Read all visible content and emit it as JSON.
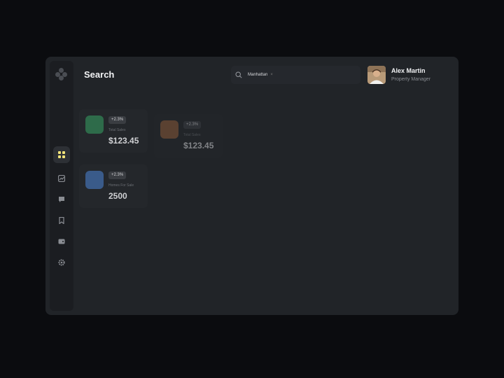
{
  "header": {
    "title": "Search"
  },
  "search": {
    "value": "Manhattan",
    "clear": "×"
  },
  "user": {
    "name": "Alex Martin",
    "role": "Property Manager"
  },
  "cards": [
    {
      "badge": "+2.3%",
      "label": "Total Sales",
      "value": "$123.45",
      "color": "#2e6b4a"
    },
    {
      "badge": "+2.3%",
      "label": "Total Sales",
      "value": "$123.45",
      "color": "#8a5a3a"
    },
    {
      "badge": "+2.3%",
      "label": "Homes For Sale",
      "value": "2500",
      "color": "#3a5b8a"
    }
  ],
  "sidebar": {
    "items": [
      {
        "icon": "grid-icon",
        "active": true
      },
      {
        "icon": "chart-icon"
      },
      {
        "icon": "chat-icon"
      },
      {
        "icon": "bookmark-icon"
      },
      {
        "icon": "wallet-icon"
      },
      {
        "icon": "gear-icon"
      }
    ]
  },
  "colors": {
    "accent": "#f1e37a",
    "panel": "#212428",
    "background": "#0b0c0f"
  }
}
